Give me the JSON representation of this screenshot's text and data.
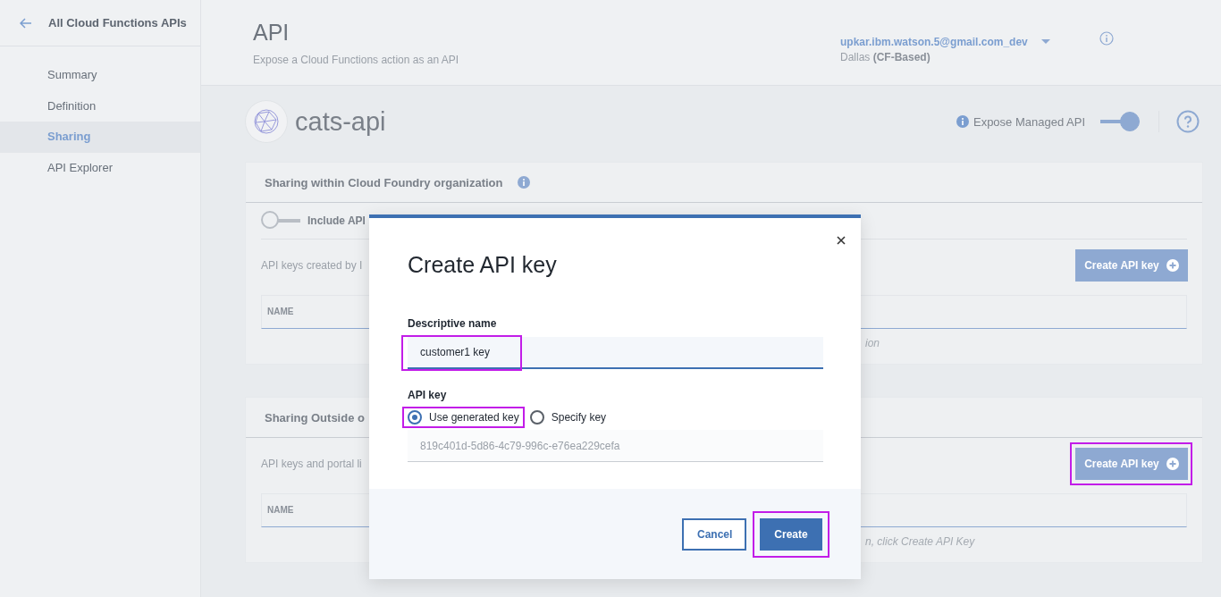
{
  "sidebar": {
    "back_label": "All Cloud Functions APIs",
    "items": [
      {
        "label": "Summary",
        "selected": false
      },
      {
        "label": "Definition",
        "selected": false
      },
      {
        "label": "Sharing",
        "selected": true
      },
      {
        "label": "API Explorer",
        "selected": false
      }
    ]
  },
  "header": {
    "title": "API",
    "subtitle": "Expose a Cloud Functions action as an API",
    "account": "upkar.ibm.watson.5@gmail.com_dev",
    "region": "Dallas **(CF-Based)**"
  },
  "api": {
    "name": "cats-api",
    "expose_label": "Expose Managed API",
    "expose_on": true
  },
  "sections": [
    {
      "title": "Sharing within Cloud Foundry organization",
      "has_info": true,
      "toggle_label": "Include API",
      "toggle_on": false,
      "description": "API keys created by I",
      "button": "Create API key",
      "button_highlighted": false,
      "column": "NAME",
      "hint": "ion"
    },
    {
      "title": "Sharing Outside o",
      "description": "API keys and portal li",
      "button": "Create API key",
      "button_highlighted": true,
      "column": "NAME",
      "hint": "n, click Create API Key"
    }
  ],
  "dialog": {
    "title": "Create API key",
    "name_label": "Descriptive name",
    "name_value": "customer1 key",
    "name_highlighted": true,
    "key_label": "API key",
    "key_options": [
      {
        "label": "Use generated key",
        "selected": true,
        "highlighted": true
      },
      {
        "label": "Specify key",
        "selected": false,
        "highlighted": false
      }
    ],
    "generated_key": "819c401d-5d86-4c79-996c-e76ea229cefa",
    "buttons": [
      {
        "label": "Cancel",
        "kind": "secondary",
        "highlighted": false
      },
      {
        "label": "Create",
        "kind": "primary",
        "highlighted": true
      }
    ]
  }
}
